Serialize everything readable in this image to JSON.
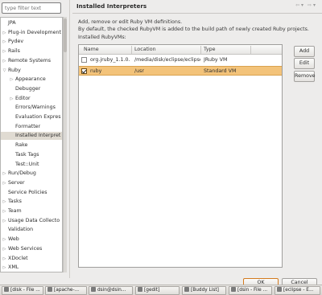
{
  "filter": {
    "placeholder": "type filter text"
  },
  "tree": [
    {
      "label": "JPA",
      "level": 0,
      "expander": ""
    },
    {
      "label": "Plug-in Development",
      "level": 0,
      "expander": "▷"
    },
    {
      "label": "Pydev",
      "level": 0,
      "expander": "▷"
    },
    {
      "label": "Rails",
      "level": 0,
      "expander": "▷"
    },
    {
      "label": "Remote Systems",
      "level": 0,
      "expander": "▷"
    },
    {
      "label": "Ruby",
      "level": 0,
      "expander": "▽"
    },
    {
      "label": "Appearance",
      "level": 1,
      "expander": "▷"
    },
    {
      "label": "Debugger",
      "level": 1,
      "expander": ""
    },
    {
      "label": "Editor",
      "level": 1,
      "expander": "▷"
    },
    {
      "label": "Errors/Warnings",
      "level": 1,
      "expander": ""
    },
    {
      "label": "Evaluation Expres",
      "level": 1,
      "expander": ""
    },
    {
      "label": "Formatter",
      "level": 1,
      "expander": ""
    },
    {
      "label": "Installed Interpret",
      "level": 1,
      "expander": "",
      "selected": true
    },
    {
      "label": "Rake",
      "level": 1,
      "expander": ""
    },
    {
      "label": "Task Tags",
      "level": 1,
      "expander": ""
    },
    {
      "label": "Test::Unit",
      "level": 1,
      "expander": ""
    },
    {
      "label": "Run/Debug",
      "level": 0,
      "expander": "▷"
    },
    {
      "label": "Server",
      "level": 0,
      "expander": "▷"
    },
    {
      "label": "Service Policies",
      "level": 0,
      "expander": ""
    },
    {
      "label": "Tasks",
      "level": 0,
      "expander": "▷"
    },
    {
      "label": "Team",
      "level": 0,
      "expander": "▷"
    },
    {
      "label": "Usage Data Collecto",
      "level": 0,
      "expander": "▷"
    },
    {
      "label": "Validation",
      "level": 0,
      "expander": ""
    },
    {
      "label": "Web",
      "level": 0,
      "expander": "▷"
    },
    {
      "label": "Web Services",
      "level": 0,
      "expander": "▷"
    },
    {
      "label": "XDoclet",
      "level": 0,
      "expander": "▷"
    },
    {
      "label": "XML",
      "level": 0,
      "expander": "▷"
    }
  ],
  "page": {
    "title": "Installed Interpreters",
    "description_line1": "Add, remove or edit Ruby VM definitions.",
    "description_line2": "By default, the checked RubyVM is added to the build path of newly created Ruby projects.",
    "installed_label": "Installed RubyVMs:"
  },
  "table": {
    "columns": [
      "Name",
      "Location",
      "Type"
    ],
    "rows": [
      {
        "checked": false,
        "name": "org.jruby_1.1.0.",
        "location": "/media/disk/eclipse/eclipse/plugins/org",
        "type": "JRuby VM",
        "selected": false
      },
      {
        "checked": true,
        "name": "ruby",
        "location": "/usr",
        "type": "Standard VM",
        "selected": true
      }
    ]
  },
  "buttons": {
    "add": "Add",
    "edit": "Edit",
    "remove": "Remove",
    "ok": "OK",
    "cancel": "Cancel"
  },
  "taskbar": [
    "[disk - File ...",
    "[apache-...",
    "dsin@dsin...",
    "[gedit]",
    "[Buddy List]",
    "[dsin - File ...",
    "[eclipse - E..."
  ],
  "colors": {
    "selection": "#f3c37a",
    "tree_selection": "#e0dbd2",
    "default_button_border": "#d37a1e"
  }
}
